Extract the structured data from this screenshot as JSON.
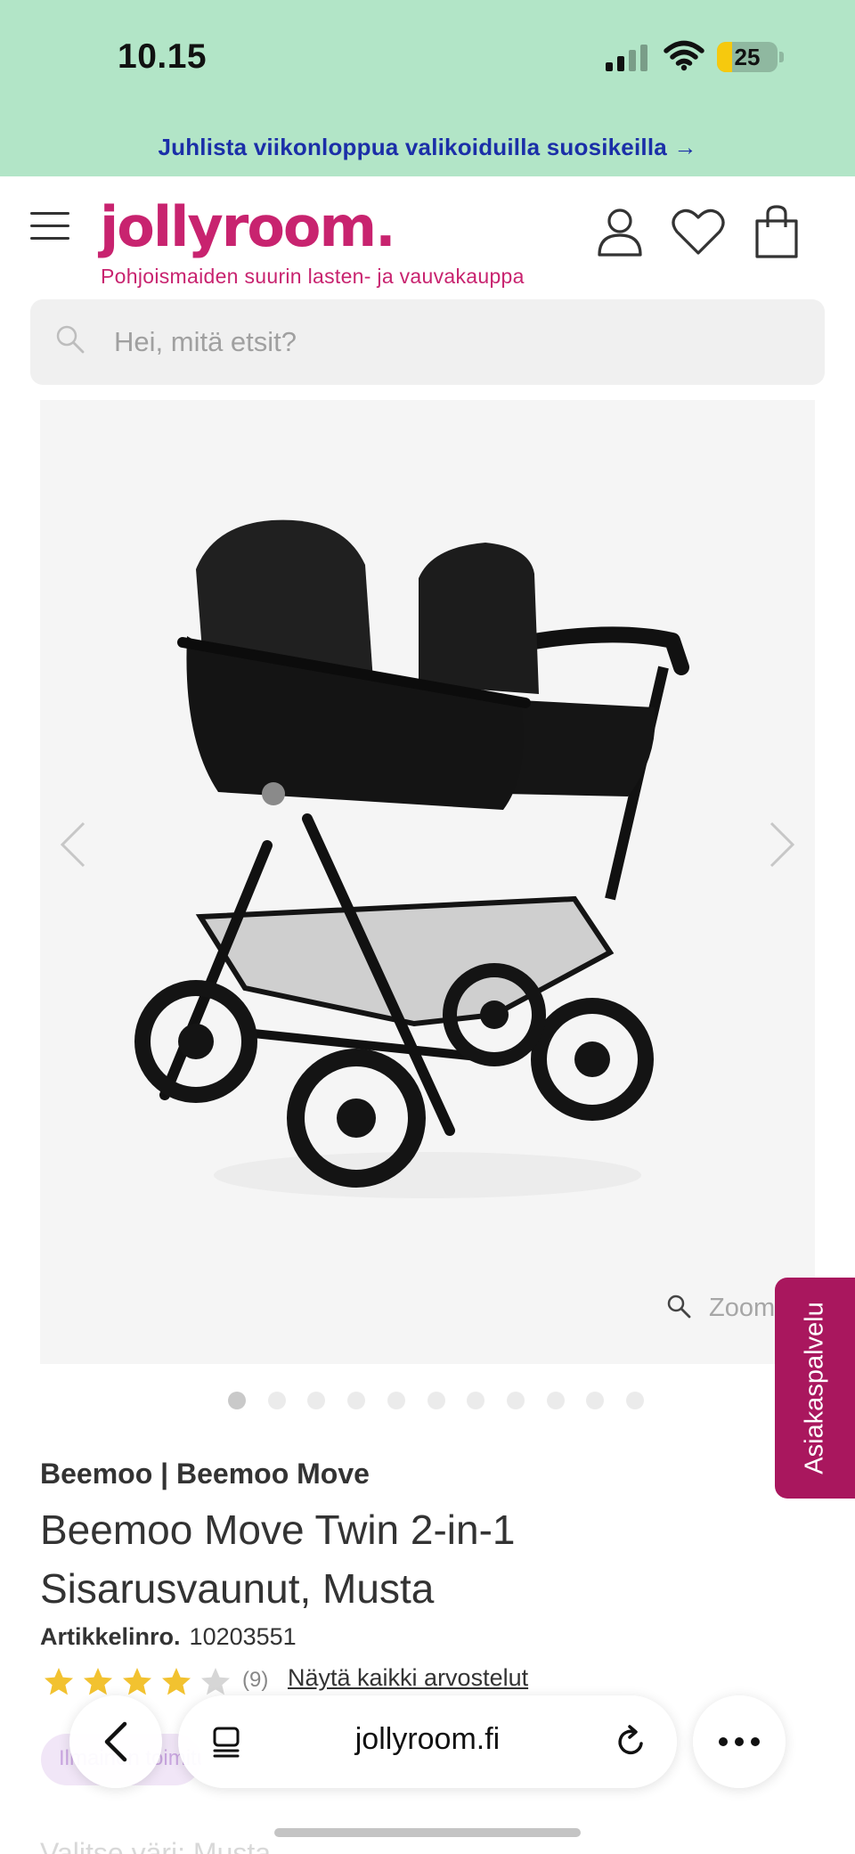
{
  "status_bar": {
    "time": "10.15",
    "battery_level": "25",
    "battery_fraction": 0.25,
    "icons": [
      "signal-icon",
      "wifi-icon",
      "battery-icon"
    ]
  },
  "promo": {
    "text": "Juhlista viikonloppua valikoiduilla suosikeilla →"
  },
  "header": {
    "logo": "jollyroom.",
    "tagline": "Pohjoismaiden suurin lasten- ja vauvakauppa",
    "icons": [
      "menu-icon",
      "account-icon",
      "wishlist-heart-icon",
      "cart-bag-icon"
    ]
  },
  "search": {
    "placeholder": "Hei, mitä etsit?",
    "value": ""
  },
  "gallery": {
    "zoom_label": "Zoom",
    "image_count": 11,
    "active_index": 0
  },
  "side_tab": {
    "label": "Asiakaspalvelu"
  },
  "product": {
    "brand": "Beemoo | Beemoo Move",
    "title": "Beemoo Move Twin 2-in-1 Sisarusvaunut, Musta",
    "sku_label": "Artikkelinro.",
    "sku_value": "10203551",
    "rating": 4,
    "rating_max": 5,
    "review_count": "(9)",
    "reviews_link": "Näytä kaikki arvostelut",
    "pill_text": "Ilmainen toimitus",
    "next_section_text": "Valitse väri: Musta"
  },
  "browser": {
    "url": "jollyroom.fi",
    "icons": [
      "back-chevron-icon",
      "tabs-icon",
      "reload-icon",
      "more-icon"
    ]
  },
  "colors": {
    "brand_pink": "#c8236f",
    "promo_bg": "#b2e5c7",
    "promo_text": "#1b2fa8",
    "side_tab_bg": "#a9175e",
    "star": "#f2c230"
  }
}
